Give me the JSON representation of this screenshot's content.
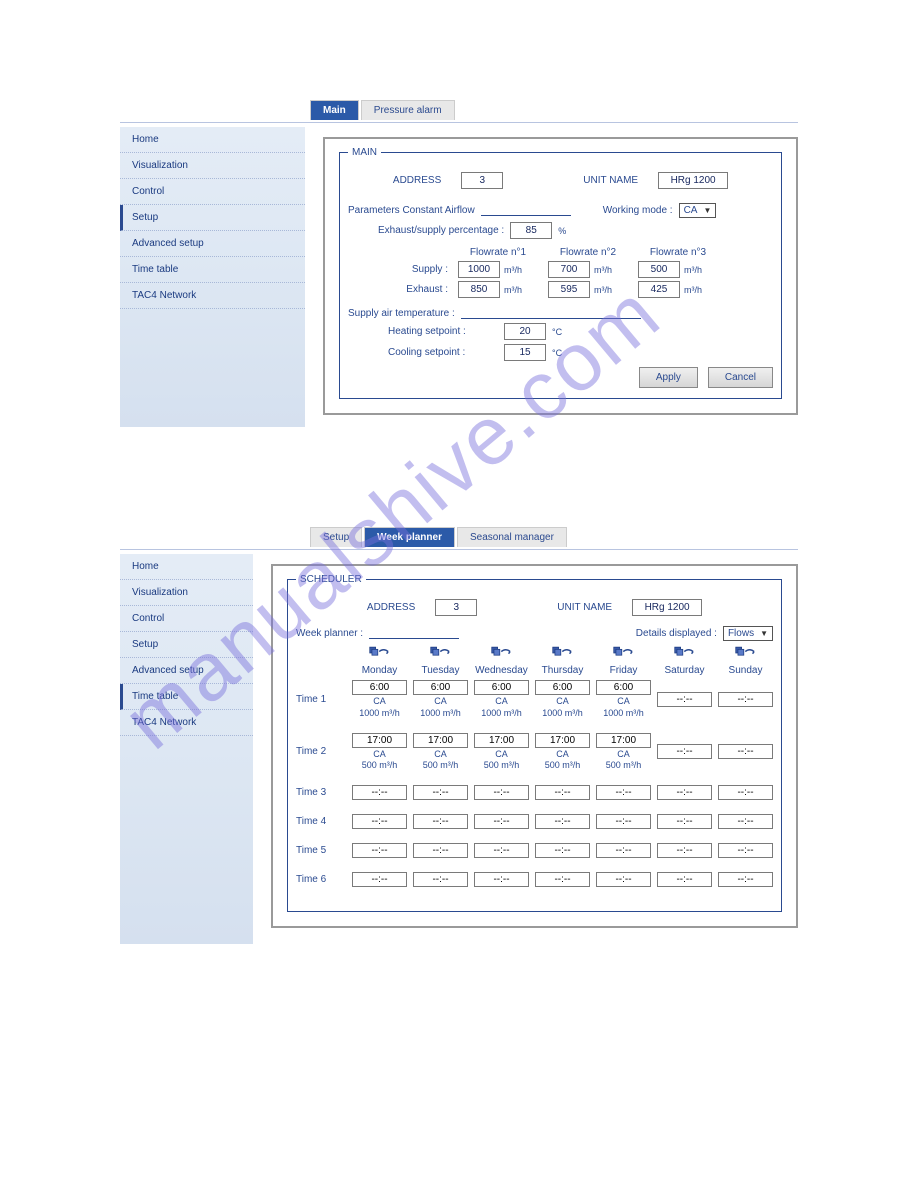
{
  "watermark": "manualshive.com",
  "section1": {
    "tabs": [
      {
        "label": "Main",
        "active": true
      },
      {
        "label": "Pressure alarm",
        "active": false
      }
    ],
    "sidebar": [
      "Home",
      "Visualization",
      "Control",
      "Setup",
      "Advanced setup",
      "Time table",
      "TAC4 Network"
    ],
    "sidebar_active": "Setup",
    "main": {
      "legend": "MAIN",
      "address_label": "ADDRESS",
      "address_value": "3",
      "unit_name_label": "UNIT NAME",
      "unit_name_value": "HRg 1200",
      "params_label": "Parameters Constant Airflow",
      "working_mode_label": "Working mode :",
      "working_mode_value": "CA",
      "exhaust_pct_label": "Exhaust/supply percentage :",
      "exhaust_pct_value": "85",
      "exhaust_pct_unit": "%",
      "flow_headers": [
        "Flowrate n°1",
        "Flowrate n°2",
        "Flowrate n°3"
      ],
      "supply_label": "Supply :",
      "supply_values": [
        "1000",
        "700",
        "500"
      ],
      "flow_unit": "m³/h",
      "exhaust_label": "Exhaust :",
      "exhaust_values": [
        "850",
        "595",
        "425"
      ],
      "sat_label": "Supply air temperature :",
      "heat_label": "Heating setpoint :",
      "heat_value": "20",
      "heat_unit": "°C",
      "cool_label": "Cooling setpoint :",
      "cool_value": "15",
      "cool_unit": "°C",
      "apply": "Apply",
      "cancel": "Cancel"
    }
  },
  "section2": {
    "tabs": [
      {
        "label": "Setup",
        "active": false
      },
      {
        "label": "Week planner",
        "active": true
      },
      {
        "label": "Seasonal manager",
        "active": false
      }
    ],
    "sidebar": [
      "Home",
      "Visualization",
      "Control",
      "Setup",
      "Advanced setup",
      "Time table",
      "TAC4 Network"
    ],
    "sidebar_active": "Time table",
    "sched": {
      "legend": "SCHEDULER",
      "address_label": "ADDRESS",
      "address_value": "3",
      "unit_name_label": "UNIT NAME",
      "unit_name_value": "HRg 1200",
      "week_label": "Week planner :",
      "details_label": "Details displayed :",
      "details_value": "Flows",
      "days": [
        "Monday",
        "Tuesday",
        "Wednesday",
        "Thursday",
        "Friday",
        "Saturday",
        "Sunday"
      ],
      "rows": [
        {
          "label": "Time 1",
          "cells": [
            {
              "t": "6:00",
              "s1": "CA",
              "s2": "1000 m³/h"
            },
            {
              "t": "6:00",
              "s1": "CA",
              "s2": "1000 m³/h"
            },
            {
              "t": "6:00",
              "s1": "CA",
              "s2": "1000 m³/h"
            },
            {
              "t": "6:00",
              "s1": "CA",
              "s2": "1000 m³/h"
            },
            {
              "t": "6:00",
              "s1": "CA",
              "s2": "1000 m³/h"
            },
            {
              "t": "--:--"
            },
            {
              "t": "--:--"
            }
          ]
        },
        {
          "label": "Time 2",
          "cells": [
            {
              "t": "17:00",
              "s1": "CA",
              "s2": "500 m³/h"
            },
            {
              "t": "17:00",
              "s1": "CA",
              "s2": "500 m³/h"
            },
            {
              "t": "17:00",
              "s1": "CA",
              "s2": "500 m³/h"
            },
            {
              "t": "17:00",
              "s1": "CA",
              "s2": "500 m³/h"
            },
            {
              "t": "17:00",
              "s1": "CA",
              "s2": "500 m³/h"
            },
            {
              "t": "--:--"
            },
            {
              "t": "--:--"
            }
          ]
        },
        {
          "label": "Time 3",
          "cells": [
            {
              "t": "--:--"
            },
            {
              "t": "--:--"
            },
            {
              "t": "--:--"
            },
            {
              "t": "--:--"
            },
            {
              "t": "--:--"
            },
            {
              "t": "--:--"
            },
            {
              "t": "--:--"
            }
          ]
        },
        {
          "label": "Time 4",
          "cells": [
            {
              "t": "--:--"
            },
            {
              "t": "--:--"
            },
            {
              "t": "--:--"
            },
            {
              "t": "--:--"
            },
            {
              "t": "--:--"
            },
            {
              "t": "--:--"
            },
            {
              "t": "--:--"
            }
          ]
        },
        {
          "label": "Time 5",
          "cells": [
            {
              "t": "--:--"
            },
            {
              "t": "--:--"
            },
            {
              "t": "--:--"
            },
            {
              "t": "--:--"
            },
            {
              "t": "--:--"
            },
            {
              "t": "--:--"
            },
            {
              "t": "--:--"
            }
          ]
        },
        {
          "label": "Time 6",
          "cells": [
            {
              "t": "--:--"
            },
            {
              "t": "--:--"
            },
            {
              "t": "--:--"
            },
            {
              "t": "--:--"
            },
            {
              "t": "--:--"
            },
            {
              "t": "--:--"
            },
            {
              "t": "--:--"
            }
          ]
        }
      ]
    }
  }
}
